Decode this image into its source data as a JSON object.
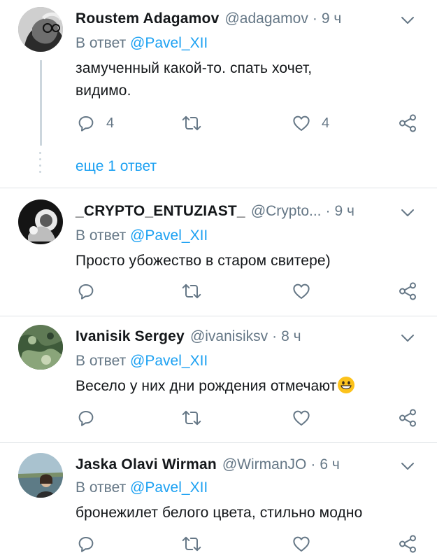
{
  "tweets": [
    {
      "name": "Roustem Adagamov",
      "handle": "@adagamov",
      "separator": "·",
      "time": "9 ч",
      "reply_prefix": "В ответ",
      "reply_mention": "@Pavel_XII",
      "text_line1": "замученный какой-то. спать хочет,",
      "text_line2": "видимо.",
      "reply_count": "4",
      "retweet_count": "",
      "like_count": "4",
      "more_replies": "еще 1 ответ"
    },
    {
      "name": "_CRYPTO_ENTUZIAST_",
      "handle": "@Crypto...",
      "separator": "·",
      "time": "9 ч",
      "reply_prefix": "В ответ",
      "reply_mention": "@Pavel_XII",
      "text_line1": "Просто убожество в старом свитере)",
      "reply_count": "",
      "retweet_count": "",
      "like_count": ""
    },
    {
      "name": "Ivanisik Sergey",
      "handle": "@ivanisiksv",
      "separator": "·",
      "time": "8 ч",
      "reply_prefix": "В ответ",
      "reply_mention": "@Pavel_XII",
      "text_line1": "Весело у них дни рождения отмечают",
      "emoji": "grinning-face-emoji",
      "reply_count": "",
      "retweet_count": "",
      "like_count": ""
    },
    {
      "name": "Jaska Olavi Wirman",
      "handle": "@WirmanJO",
      "separator": "·",
      "time": "6 ч",
      "reply_prefix": "В ответ",
      "reply_mention": "@Pavel_XII",
      "text_line1": "бронежилет белого цвета, стильно модно",
      "reply_count": "",
      "retweet_count": "",
      "like_count": ""
    }
  ],
  "colors": {
    "text": "#14171a",
    "secondary": "#657786",
    "link": "#1da1f2",
    "divider": "#dfe3e6",
    "thread_line": "#ccd6dd"
  },
  "icons": {
    "reply": "reply-bubble-icon",
    "retweet": "retweet-icon",
    "like": "heart-icon",
    "share": "share-icon",
    "menu": "chevron-down-icon"
  }
}
